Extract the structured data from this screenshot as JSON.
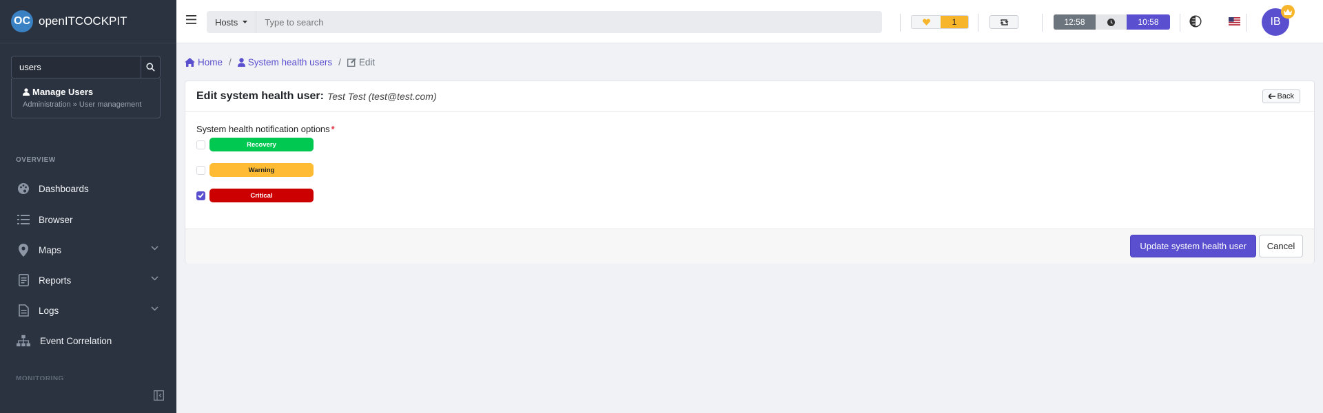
{
  "brand": {
    "logo_text": "OC",
    "name": "openITCOCKPIT"
  },
  "sidebar": {
    "search": {
      "value": "users"
    },
    "result": {
      "title": "Manage Users",
      "path": "Administration » User management"
    },
    "section_overview": "OVERVIEW",
    "section_monitoring": "MONITORING",
    "items": [
      {
        "label": "Dashboards",
        "icon": "palette-icon"
      },
      {
        "label": "Browser",
        "icon": "list-icon"
      },
      {
        "label": "Maps",
        "icon": "map-marker-icon",
        "expandable": true
      },
      {
        "label": "Reports",
        "icon": "report-icon",
        "expandable": true
      },
      {
        "label": "Logs",
        "icon": "file-icon",
        "expandable": true
      },
      {
        "label": "Event Correlation",
        "icon": "sitemap-icon"
      }
    ]
  },
  "topbar": {
    "search_type": "Hosts",
    "search_placeholder": "Type to search",
    "badge_count": "1",
    "clock_left": "12:58",
    "clock_right": "10:58",
    "avatar_initials": "IB"
  },
  "breadcrumb": {
    "home": "Home",
    "parent": "System health users",
    "current": "Edit"
  },
  "card": {
    "title": "Edit system health user:",
    "subtitle": "Test Test (test@test.com)",
    "back_label": "Back",
    "field_label": "System health notification options",
    "options": [
      {
        "label": "Recovery",
        "checked": false,
        "color": "#00c851"
      },
      {
        "label": "Warning",
        "checked": false,
        "color": "#ffbb33"
      },
      {
        "label": "Critical",
        "checked": true,
        "color": "#cc0000"
      }
    ],
    "submit_label": "Update system health user",
    "cancel_label": "Cancel"
  },
  "colors": {
    "accent": "#5a4fcf",
    "sidebar_bg": "#2b3340"
  }
}
